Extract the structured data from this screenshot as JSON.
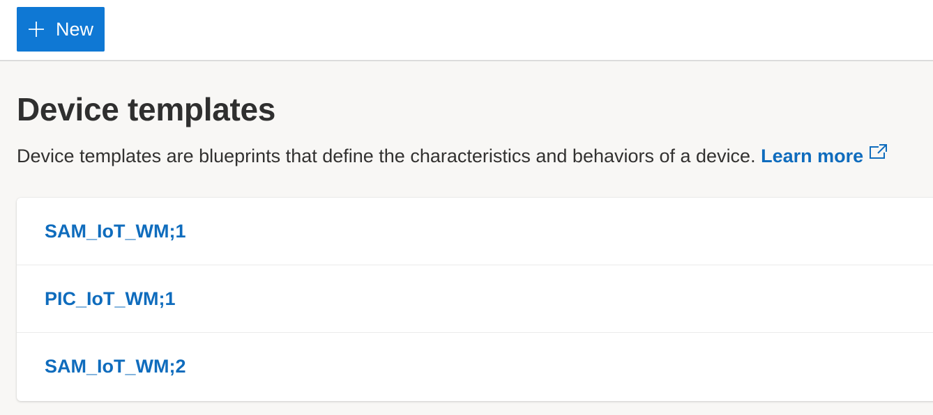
{
  "toolbar": {
    "new_button_label": "New",
    "new_button_icon": "plus-icon"
  },
  "header": {
    "title": "Device templates",
    "description": "Device templates are blueprints that define the characteristics and behaviors of a device.",
    "learn_more_label": "Learn more",
    "learn_more_icon": "external-link-icon"
  },
  "templates": [
    {
      "name": "SAM_IoT_WM;1"
    },
    {
      "name": "PIC_IoT_WM;1"
    },
    {
      "name": "SAM_IoT_WM;2"
    }
  ],
  "colors": {
    "accent": "#0f78d4",
    "link": "#0f6cbd",
    "page_background": "#f8f7f5",
    "text": "#323130"
  }
}
